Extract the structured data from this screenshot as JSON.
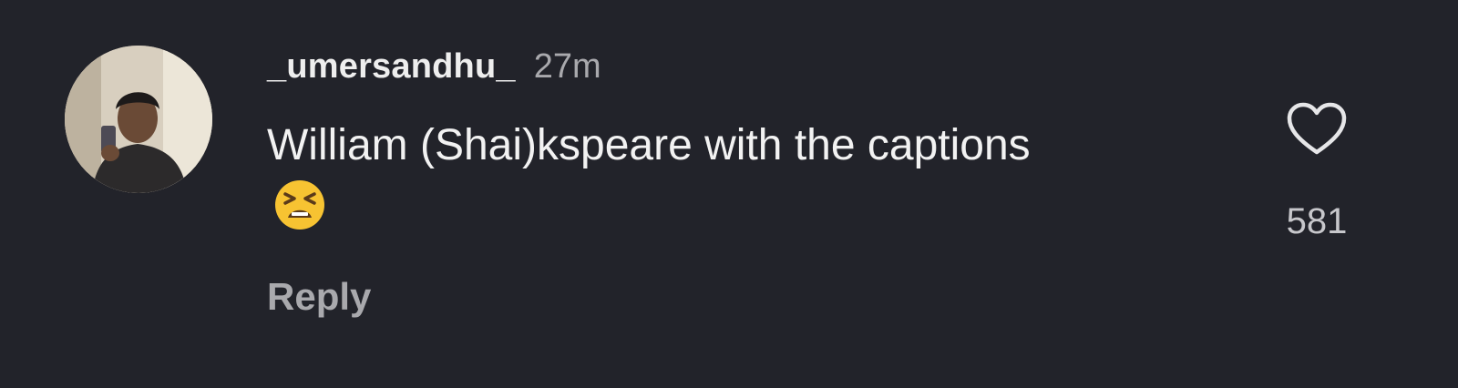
{
  "comment": {
    "username": "_umersandhu_",
    "timestamp": "27m",
    "text": "William (Shai)kspeare with the captions",
    "emoji_icon": "tired-face-emoji",
    "reply_label": "Reply",
    "like_count": "581",
    "like_icon": "heart-outline-icon"
  },
  "colors": {
    "background": "#22232a",
    "text_primary": "#f2f2f2",
    "text_secondary": "#a9a9ad",
    "emoji": "#f7c332"
  }
}
